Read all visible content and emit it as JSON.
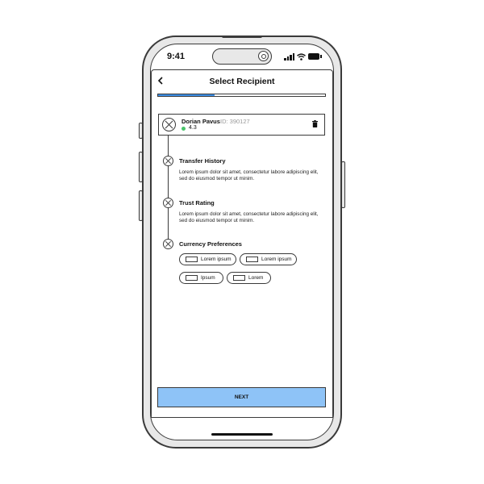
{
  "status_bar": {
    "time": "9:41"
  },
  "header": {
    "back_icon": "chevron-left-icon",
    "title": "Select Recipient"
  },
  "progress": {
    "fraction": 0.34,
    "accent": "#3d8fe6"
  },
  "recipient": {
    "name": "Dorian Pavus",
    "id_label": "ID: 390127",
    "rating": "4.3",
    "rating_color": "#49c46a"
  },
  "sections": [
    {
      "title": "Transfer History",
      "body": "Lorem ipsum dolor sit amet, consectetur labore adipiscing elit, sed do eiusmod tempor ut minim."
    },
    {
      "title": "Trust Rating",
      "body": "Lorem ipsum dolor sit amet, consectetur labore adipiscing elit, sed do eiusmod tempor ut minim."
    },
    {
      "title": "Currency Preferences"
    }
  ],
  "currency_options": [
    "Lorem ipsum",
    "Lorem ipsum",
    "Ipsum",
    "Lorem"
  ],
  "next_button": {
    "label": "NEXT",
    "color": "#8ec3f7"
  }
}
